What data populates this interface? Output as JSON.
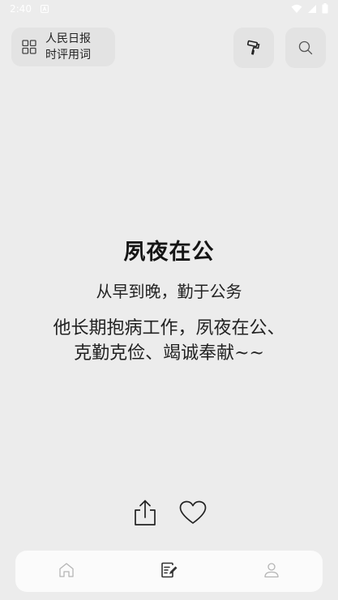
{
  "status_bar": {
    "time": "2:40"
  },
  "header": {
    "category_line1": "人民日报",
    "category_line2": "时评用词",
    "theme_icon": "paint-roller-icon",
    "search_icon": "search-icon"
  },
  "word": {
    "title": "夙夜在公",
    "meaning": "从早到晚，勤于公务",
    "example_line1": "他长期抱病工作，夙夜在公、",
    "example_line2": "克勤克俭、竭诚奉献~~"
  },
  "actions": {
    "share_icon": "share-icon",
    "favorite_icon": "heart-icon"
  },
  "bottom_nav": {
    "items": [
      "home-icon",
      "words-icon",
      "profile-icon"
    ],
    "active_index": 1
  },
  "colors": {
    "background": "#ececec",
    "card": "#e3e3e3",
    "nav_background": "#fbfbfb",
    "text": "#1a1a1a",
    "inactive_icon": "#b5b5b5"
  }
}
